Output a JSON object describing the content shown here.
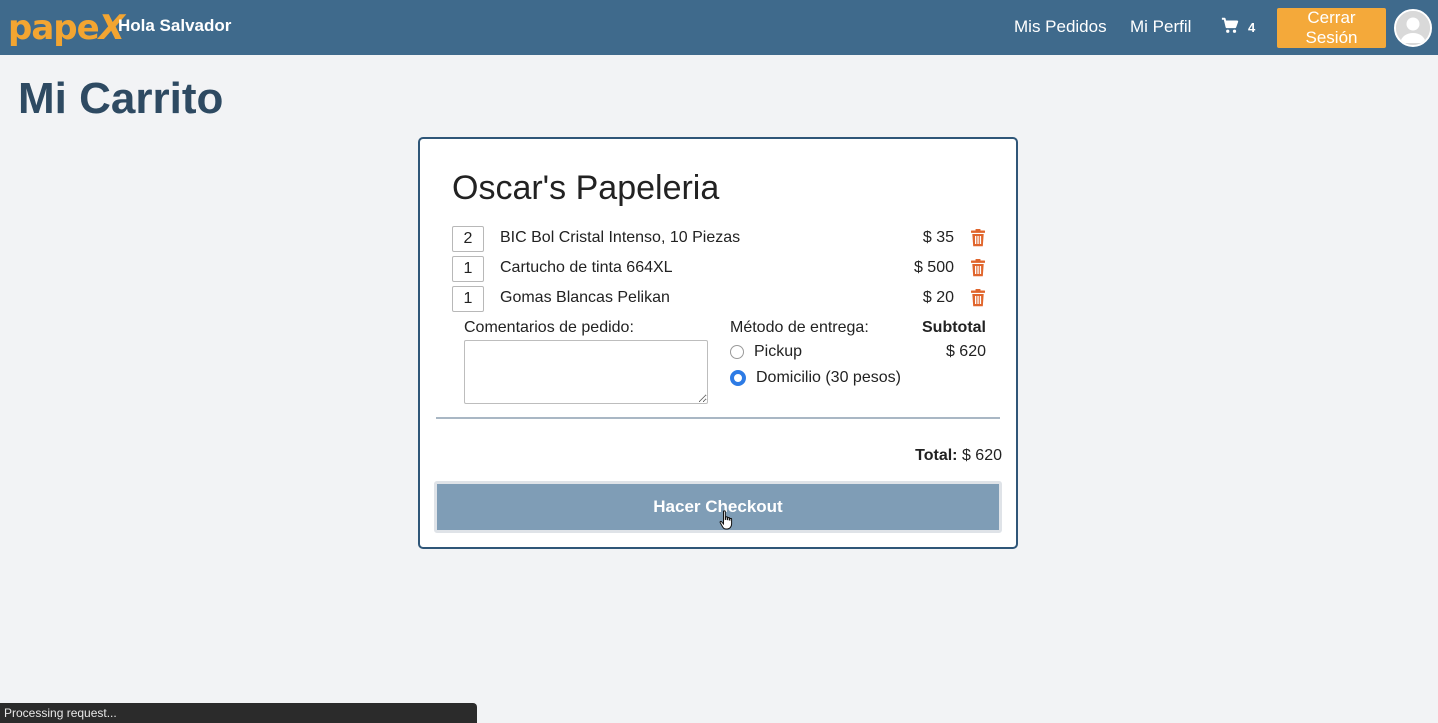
{
  "nav": {
    "logo_text": "pape",
    "logo_x": "X",
    "greeting": "Hola Salvador",
    "orders_link": "Mis Pedidos",
    "profile_link": "Mi Perfil",
    "cart_count": "4",
    "logout_label": "Cerrar Sesión"
  },
  "page": {
    "title": "Mi Carrito"
  },
  "cart": {
    "store_name": "Oscar's Papeleria",
    "items": [
      {
        "qty": "2",
        "name": "BIC Bol Cristal Intenso, 10 Piezas",
        "price": "$ 35"
      },
      {
        "qty": "1",
        "name": "Cartucho de tinta 664XL",
        "price": "$ 500"
      },
      {
        "qty": "1",
        "name": "Gomas Blancas Pelikan",
        "price": "$ 20"
      }
    ],
    "comments_label": "Comentarios de pedido:",
    "comments_value": "",
    "delivery_label": "Método de entrega:",
    "delivery_options": [
      {
        "label": "Pickup",
        "selected": false
      },
      {
        "label": "Domicilio (30 pesos)",
        "selected": true
      }
    ],
    "subtotal_label": "Subtotal",
    "subtotal_value": "$ 620",
    "total_label": "Total:",
    "total_value": "$ 620",
    "checkout_label": "Hacer Checkout"
  },
  "status_bar": {
    "text": "Processing request..."
  },
  "colors": {
    "navbar": "#3f6a8c",
    "accent_orange": "#f4a93a",
    "trash_icon": "#e0652c",
    "checkout_button": "#7f9db6",
    "card_border": "#2f5678"
  }
}
